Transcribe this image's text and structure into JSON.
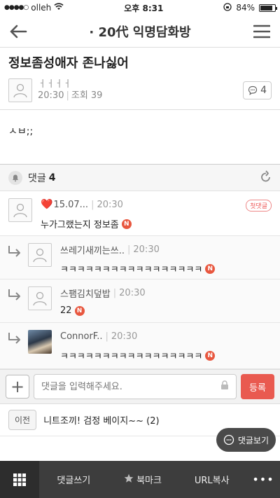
{
  "status_bar": {
    "carrier": "olleh",
    "time": "오후 8:31",
    "battery": "84%",
    "battery_level": 0.84
  },
  "nav": {
    "title": "· 20代 익명담화방",
    "back_icon": "back-arrow-icon",
    "menu_icon": "hamburger-menu-icon"
  },
  "post": {
    "title": "정보좀성애자 존나싫어",
    "author": "ㅓㅓㅓㅓ",
    "time": "20:30",
    "views": "조회 39",
    "comment_count": "4",
    "body": "ㅅㅂ;;"
  },
  "comments_header": {
    "label": "댓글",
    "count": "4"
  },
  "comments": [
    {
      "heart": "❤️",
      "author": "15.07...",
      "time": "20:30",
      "text": "누가그랬는지 정보좀",
      "badge": "N",
      "first_label": "첫댓글"
    },
    {
      "author": "쓰레기새끼는쓰..",
      "time": "20:30",
      "text": "ㅋㅋㅋㅋㅋㅋㅋㅋㅋㅋㅋㅋㅋㅋㅋㅋㅋ",
      "badge": "N"
    },
    {
      "author": "스팸김치덮밥",
      "time": "20:30",
      "text": "22",
      "badge": "N"
    },
    {
      "author": "ConnorF..",
      "time": "20:30",
      "text": "ㅋㅋㅋㅋㅋㅋㅋㅋㅋㅋㅋㅋㅋㅋㅋㅋㅋ",
      "badge": "N"
    }
  ],
  "input": {
    "placeholder": "댓글을 입력해주세요.",
    "submit": "등록"
  },
  "prev_post": {
    "tag": "이전",
    "title": "니트조끼! 검정 베이지~~ (2)"
  },
  "floating": {
    "label": "댓글보기"
  },
  "bottom_bar": {
    "write_comment": "댓글쓰기",
    "bookmark": "북마크",
    "copy_url": "URL복사",
    "more": "•••"
  },
  "colors": {
    "accent": "#e95a50",
    "badge": "#e8573f",
    "bottom_bar": "#3d3d3d"
  }
}
